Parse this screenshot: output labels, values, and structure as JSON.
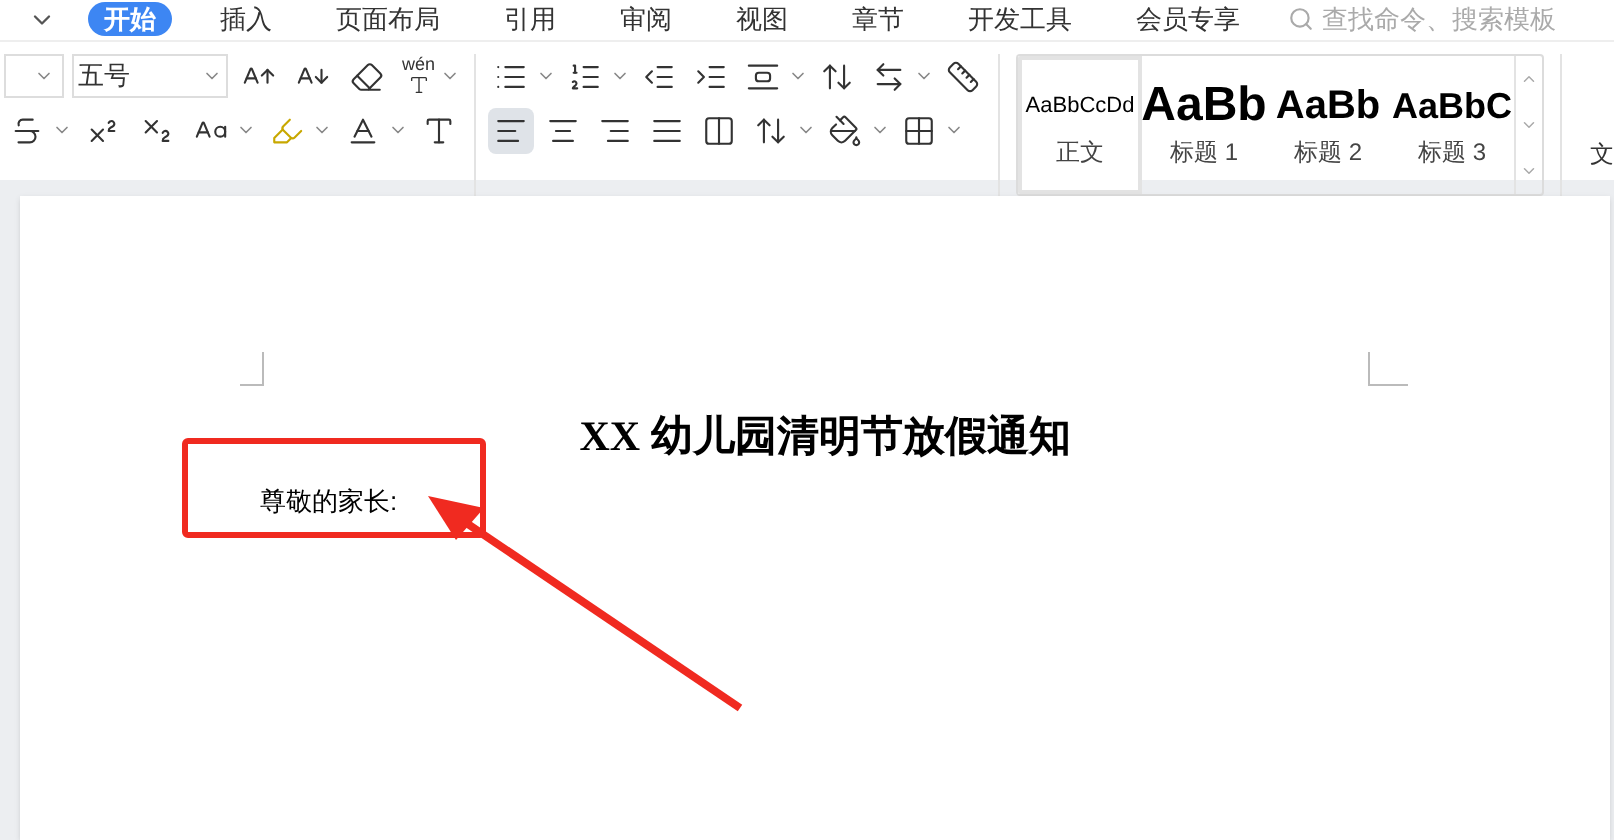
{
  "tabs": [
    {
      "label": "开始",
      "selected": true
    },
    {
      "label": "插入",
      "selected": false
    },
    {
      "label": "页面布局",
      "selected": false
    },
    {
      "label": "引用",
      "selected": false
    },
    {
      "label": "审阅",
      "selected": false
    },
    {
      "label": "视图",
      "selected": false
    },
    {
      "label": "章节",
      "selected": false
    },
    {
      "label": "开发工具",
      "selected": false
    },
    {
      "label": "会员专享",
      "selected": false
    }
  ],
  "search": {
    "placeholder": "查找命令、搜索模板"
  },
  "font_size": {
    "value": "五号"
  },
  "pinyin_icon_text": "wén",
  "paragraph_buttons": [
    {
      "kind": "align-left",
      "selected": true
    },
    {
      "kind": "align-center",
      "selected": false
    },
    {
      "kind": "align-right",
      "selected": false
    },
    {
      "kind": "justify",
      "selected": false
    },
    {
      "kind": "distribute",
      "selected": false
    }
  ],
  "styles": [
    {
      "sample": "AaBbCcDd",
      "name": "正文",
      "kind": "body",
      "selected": true
    },
    {
      "sample": "AaBb",
      "name": "标题 1",
      "kind": "h1",
      "selected": false
    },
    {
      "sample": "AaBb",
      "name": "标题 2",
      "kind": "h2",
      "selected": false
    },
    {
      "sample": "AaBbC",
      "name": "标题 3",
      "kind": "h3",
      "selected": false
    }
  ],
  "text_tool_label": "文",
  "document": {
    "title": "XX 幼儿园清明节放假通知",
    "greeting": "尊敬的家长:"
  }
}
